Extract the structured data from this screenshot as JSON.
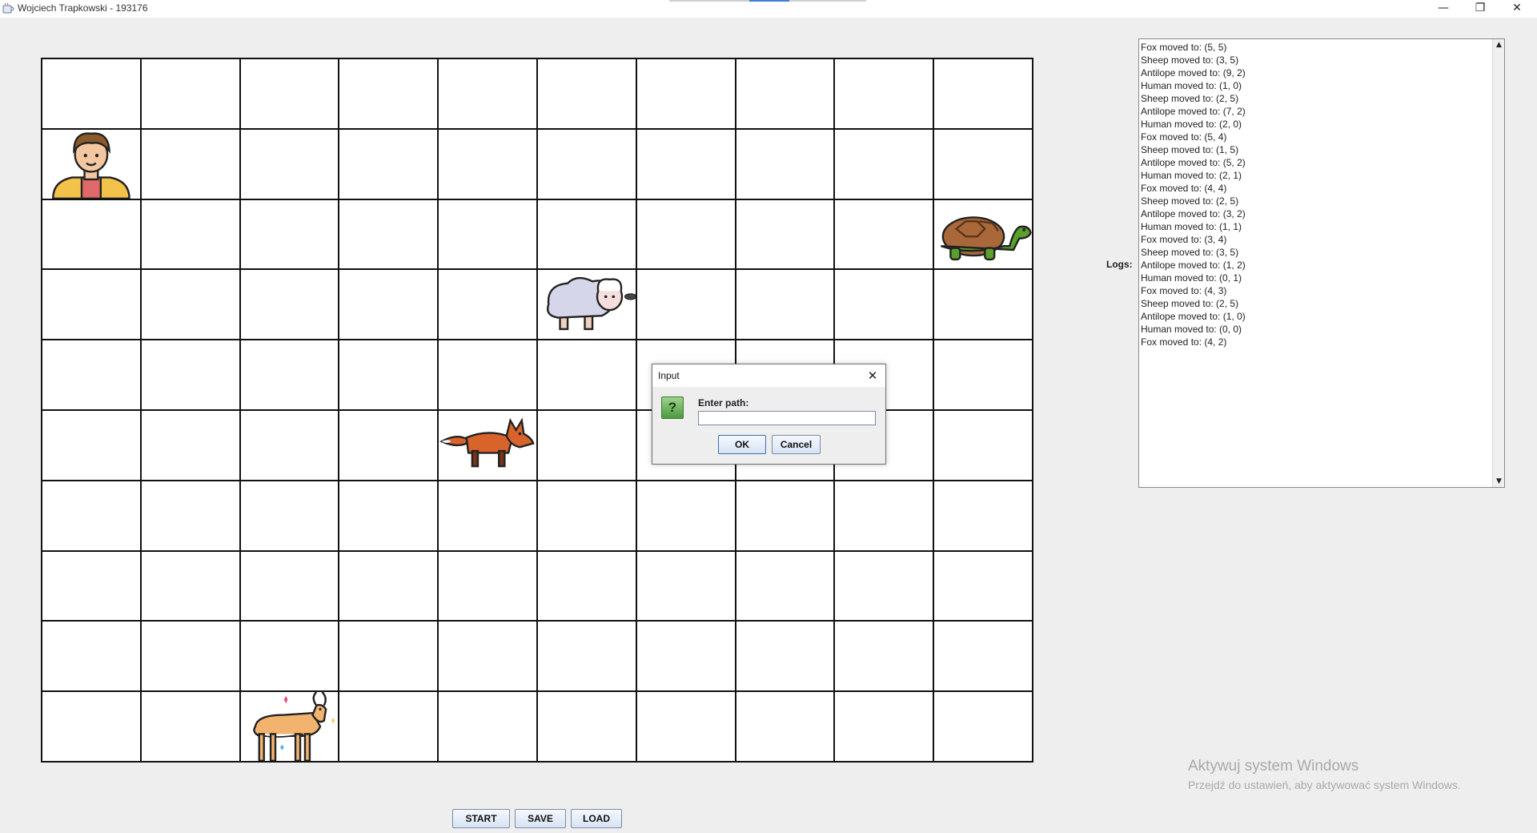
{
  "window": {
    "title": "Wojciech Trapkowski - 193176",
    "controls": [
      "—",
      "❐",
      "✕"
    ]
  },
  "board": {
    "columns": 10,
    "rows": 10,
    "organisms": [
      {
        "type": "human",
        "col": 0,
        "row": 1,
        "icon": "human-icon"
      },
      {
        "type": "turtle",
        "col": 9,
        "row": 2,
        "icon": "turtle-icon"
      },
      {
        "type": "sheep",
        "col": 5,
        "row": 3,
        "icon": "sheep-icon"
      },
      {
        "type": "fox",
        "col": 4,
        "row": 5,
        "icon": "fox-icon"
      },
      {
        "type": "antelope",
        "col": 2,
        "row": 9,
        "icon": "antelope-icon"
      }
    ]
  },
  "buttons": {
    "start": "START",
    "save": "SAVE",
    "load": "LOAD"
  },
  "logs": {
    "label": "Logs:",
    "lines": [
      "Fox moved to: (5, 5)",
      "Sheep moved to: (3, 5)",
      "Antilope moved to: (9, 2)",
      "Human moved to: (1, 0)",
      "Sheep moved to: (2, 5)",
      "Antilope moved to: (7, 2)",
      "Human moved to: (2, 0)",
      "Fox moved to: (5, 4)",
      "Sheep moved to: (1, 5)",
      "Antilope moved to: (5, 2)",
      "Human moved to: (2, 1)",
      "Fox moved to: (4, 4)",
      "Sheep moved to: (2, 5)",
      "Antilope moved to: (3, 2)",
      "Human moved to: (1, 1)",
      "Fox moved to: (3, 4)",
      "Sheep moved to: (3, 5)",
      "Antilope moved to: (1, 2)",
      "Human moved to: (0, 1)",
      "Fox moved to: (4, 3)",
      "Sheep moved to: (2, 5)",
      "Antilope moved to: (1, 0)",
      "Human moved to: (0, 0)",
      "Fox moved to: (4, 2)"
    ]
  },
  "dialog": {
    "title": "Input",
    "prompt": "Enter path:",
    "input_value": "",
    "ok_label": "OK",
    "cancel_label": "Cancel",
    "close_glyph": "✕",
    "icon_glyph": "?"
  },
  "watermark": {
    "title": "Aktywuj system Windows",
    "subtitle": "Przejdź do ustawień, aby aktywować system Windows."
  },
  "colors": {
    "background": "#eeeeee",
    "grid_line": "#111111",
    "accent_tab": "#3d7fd6"
  }
}
